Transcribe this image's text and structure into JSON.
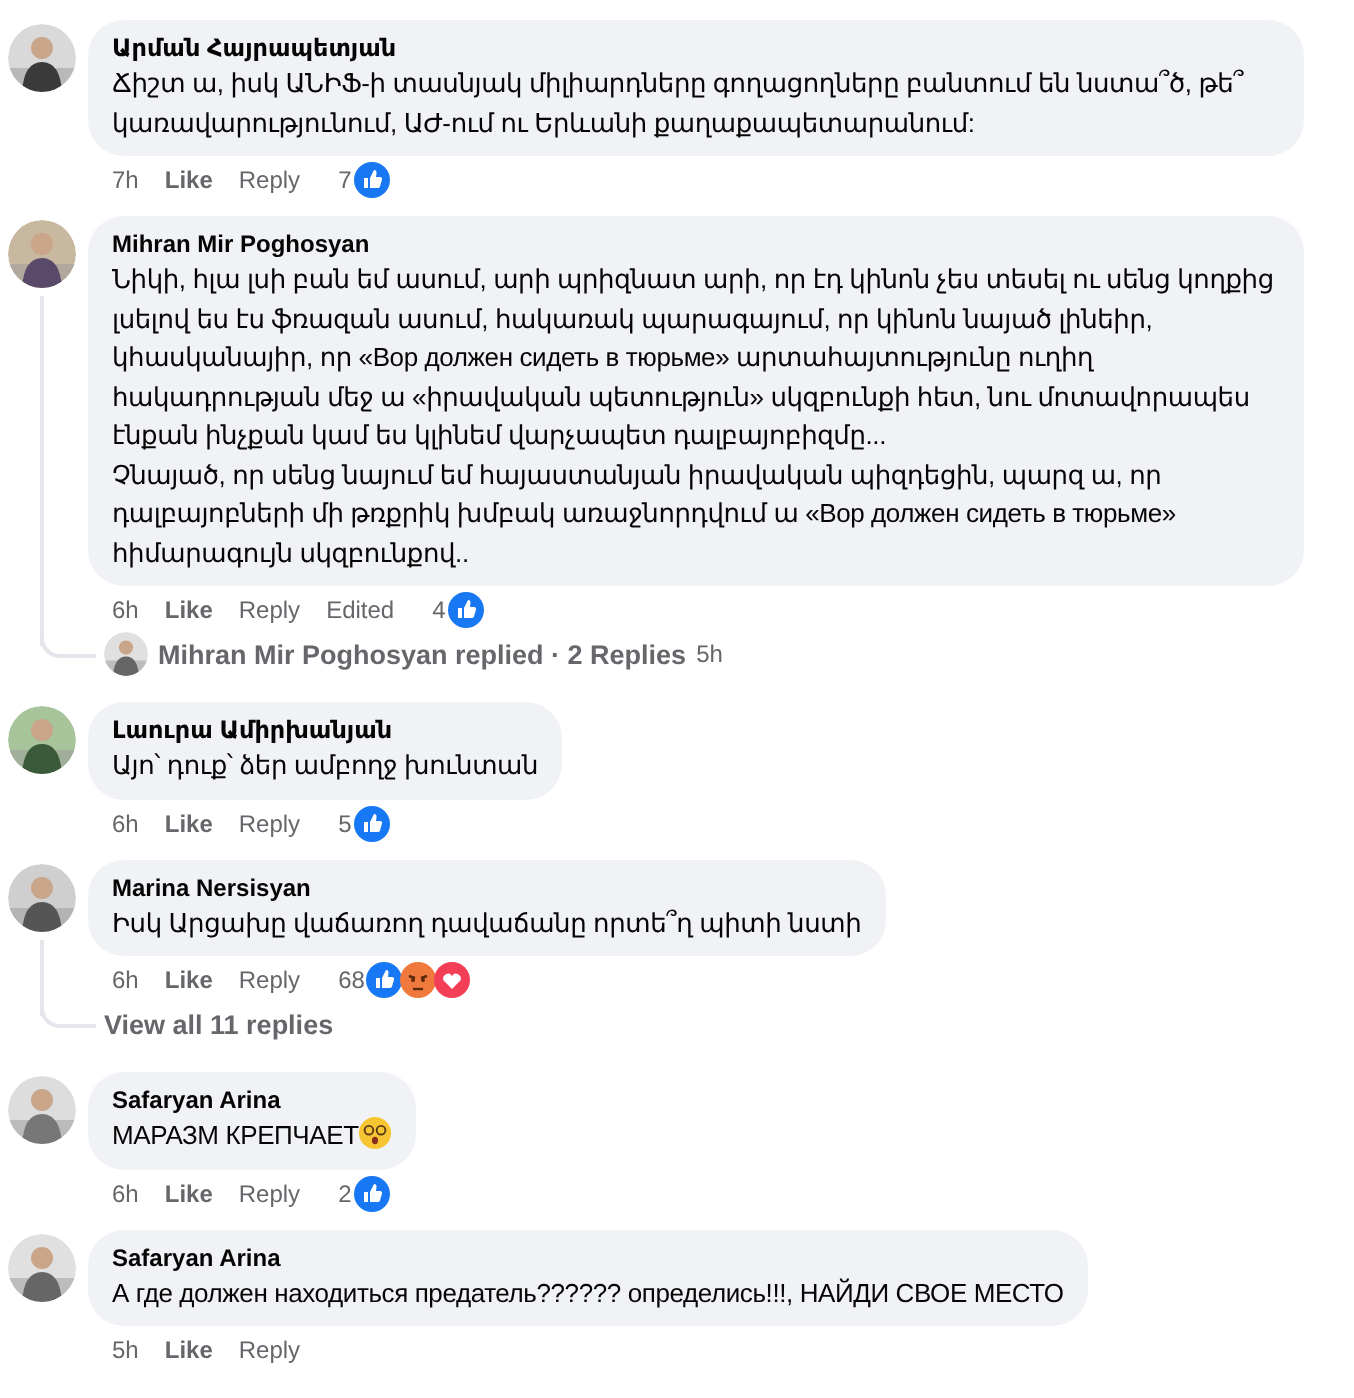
{
  "comments": [
    {
      "author": "Արման Հայրապետյան",
      "text": "Ճիշտ ա, իսկ ԱՆԻՖ-ի տասնյակ միլիարդները գողացողները բանտում են նստա՞ծ, թե՞ կառավարությունում, ԱԺ-ում ու Երևանի քաղաքապետարանում:",
      "time": "7h",
      "actions": [
        "Like",
        "Reply"
      ],
      "reaction_count": "7",
      "reactions": [
        {
          "kind": "like"
        }
      ]
    },
    {
      "author": "Mihran Mir Poghosyan",
      "text": "Նիկի, հլա լսի բան եմ ասում, արի պրիզնատ արի, որ էդ կինոն չես տեսել ու սենց կողքից լսելով ես էս ֆռազան ասում, հակառակ պարագայում, որ կինոն նայած լինեիր, կհասկանայիր, որ «Вор должен сидеть в тюрьме» արտահայտությունը ուղիղ հակադրության մեջ ա «իրավական պետություն» սկզբունքի հետ, նու մոտավորապես էնքան ինչքան կամ ես կլինեմ վարչապետ դալբայոբիզմը...\nՉնայած, որ սենց նայում եմ հայաստանյան իրավական պիզդեցին, պարզ ա, որ դալբայոբների մի թռքրիկ խմբակ առաջնորդվում ա «Вор должен сидеть в тюрьме» հիմարագույն սկզբունքով..",
      "time": "6h",
      "actions": [
        "Like",
        "Reply"
      ],
      "edited": "Edited",
      "reaction_count": "4",
      "reactions": [
        {
          "kind": "like"
        }
      ],
      "thread": {
        "kind": "replied",
        "label": "Mihran Mir Poghosyan replied · 2 Replies",
        "time": "5h"
      }
    },
    {
      "author": "Լաուրա Ամիրխանյան",
      "text": "Այո՝ դուք՝ ձեր ամբողջ խունտան",
      "time": "6h",
      "actions": [
        "Like",
        "Reply"
      ],
      "reaction_count": "5",
      "reactions": [
        {
          "kind": "like"
        }
      ]
    },
    {
      "author": "Marina Nersisyan",
      "text": "Իսկ Արցախը վաճառող դավաճանը որտե՞ղ պիտի նստի",
      "time": "6h",
      "actions": [
        "Like",
        "Reply"
      ],
      "reaction_count": "68",
      "reactions": [
        {
          "kind": "like"
        },
        {
          "kind": "angry"
        },
        {
          "kind": "love"
        }
      ],
      "thread": {
        "kind": "view_all",
        "label": "View all 11 replies"
      }
    },
    {
      "author": "Safaryan Arina",
      "text": "МАРАЗМ КРЕПЧАЕТ",
      "emoji": {
        "kind": "dizzy"
      },
      "time": "6h",
      "actions": [
        "Like",
        "Reply"
      ],
      "reaction_count": "2",
      "reactions": [
        {
          "kind": "like"
        }
      ]
    },
    {
      "author": "Safaryan Arina",
      "text": "А где должен находиться предатель?????? определись!!!, НАЙДИ СВОЕ МЕСТО",
      "time": "5h",
      "actions": [
        "Like",
        "Reply"
      ]
    }
  ]
}
